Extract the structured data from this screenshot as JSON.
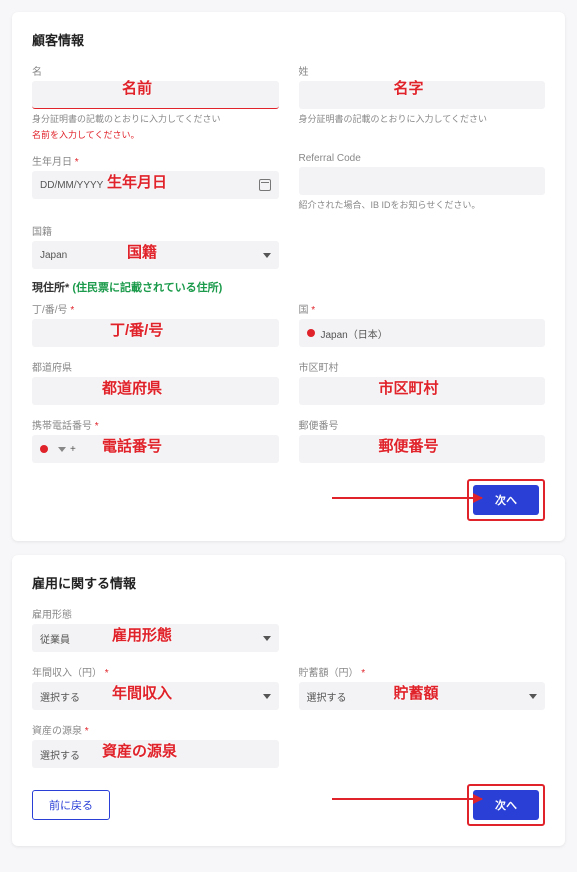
{
  "card1": {
    "title": "顧客情報",
    "name_last_label": "名",
    "name_first_label": "姓",
    "id_helper": "身分証明書の記載のとおりに入力してください",
    "name_error": "名前を入力してください。",
    "dob_label": "生年月日",
    "dob_placeholder": "DD/MM/YYYY",
    "referral_label": "Referral Code",
    "referral_helper": "紹介された場合、IB IDをお知らせください。",
    "nationality_label": "国籍",
    "nationality_value": "Japan",
    "address_heading": "現住所*",
    "address_note": " (住民票に記載されている住所)",
    "street_label": "丁/番/号",
    "country_label": "国",
    "country_value": "Japan（日本）",
    "prefecture_label": "都道府県",
    "city_label": "市区町村",
    "phone_label": "携帯電話番号",
    "phone_prefix": "+",
    "postal_label": "郵便番号",
    "next": "次へ"
  },
  "annotations1": {
    "name": "名前",
    "surname": "名字",
    "dob": "生年月日",
    "nationality": "国籍",
    "street": "丁/番/号",
    "prefecture": "都道府県",
    "city": "市区町村",
    "phone": "電話番号",
    "postal": "郵便番号"
  },
  "card2": {
    "title": "雇用に関する情報",
    "employment_label": "雇用形態",
    "employment_value": "従業員",
    "income_label": "年間収入（円）",
    "savings_label": "貯蓄額（円）",
    "source_label": "資産の源泉",
    "select_placeholder": "選択する",
    "back": "前に戻る",
    "next": "次へ"
  },
  "annotations2": {
    "employment": "雇用形態",
    "income": "年間収入",
    "savings": "貯蓄額",
    "source": "資産の源泉"
  }
}
